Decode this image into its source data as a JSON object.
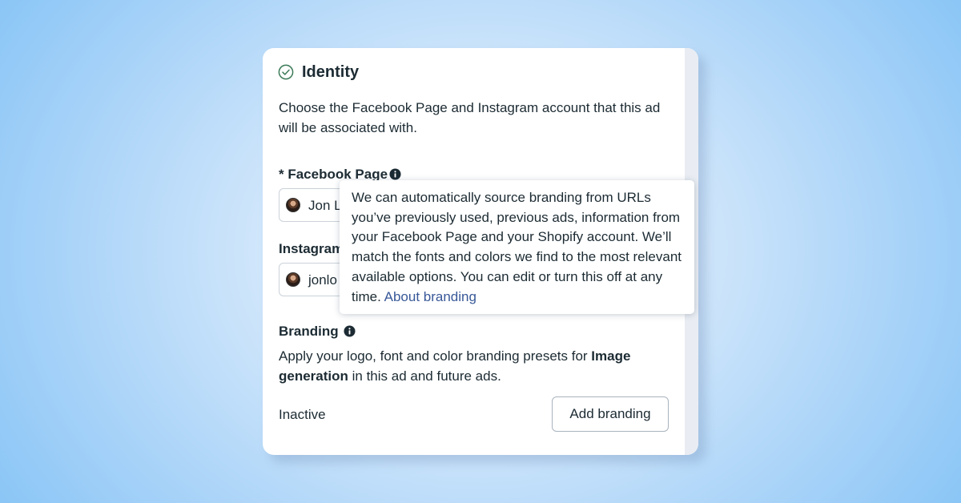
{
  "identity": {
    "title": "Identity",
    "description": "Choose the Facebook Page and Instagram account that this ad will be associated with."
  },
  "facebook_page": {
    "label": "* Facebook Page",
    "selected_value": "Jon L"
  },
  "instagram": {
    "label": "Instagram",
    "selected_value": "jonlo"
  },
  "branding": {
    "label": "Branding",
    "description_part1": "Apply your logo, font and color branding presets for ",
    "description_bold": "Image generation",
    "description_part2": " in this ad and future ads.",
    "status": "Inactive",
    "button_label": "Add branding"
  },
  "tooltip": {
    "text": "We can automatically source branding from URLs you’ve previously used, previous ads, information from your Facebook Page and your Shopify account. We’ll match the fonts and colors we find to the most relevant available options. You can edit or turn this off at any time. ",
    "link_label": "About branding"
  },
  "colors": {
    "check_icon": "#3b7a57",
    "link": "#385898",
    "text": "#1c2b33"
  }
}
